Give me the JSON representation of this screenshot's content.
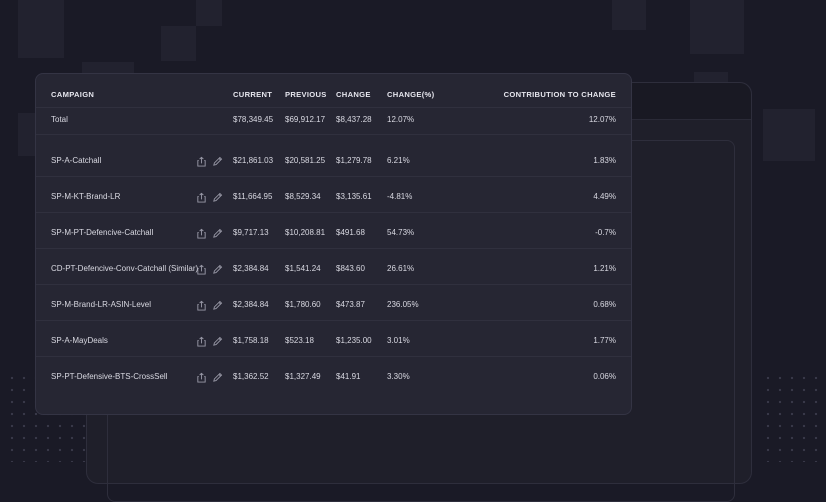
{
  "window": {
    "traffic_lights": [
      "#ff5f57",
      "#febc2e",
      "#28c840"
    ]
  },
  "table": {
    "headers": [
      "CAMPAIGN",
      "CURRENT",
      "PREVIOUS",
      "CHANGE",
      "CHANGE(%)",
      "CONTRIBUTION TO CHANGE"
    ],
    "total": {
      "campaign": "Total",
      "current": "$78,349.45",
      "previous": "$69,912.17",
      "change": "$8,437.28",
      "change_pct": "12.07%",
      "contribution": "12.07%"
    },
    "rows": [
      {
        "campaign": "SP-A-Catchall",
        "current": "$21,861.03",
        "previous": "$20,581.25",
        "change": "$1,279.78",
        "change_pct": "6.21%",
        "contribution": "1.83%"
      },
      {
        "campaign": "SP-M-KT-Brand-LR",
        "current": "$11,664.95",
        "previous": "$8,529.34",
        "change": "$3,135.61",
        "change_pct": "-4.81%",
        "contribution": "4.49%"
      },
      {
        "campaign": "SP-M-PT-Defencive-Catchall",
        "current": "$9,717.13",
        "previous": "$10,208.81",
        "change": "$491.68",
        "change_pct": "54.73%",
        "contribution": "-0.7%"
      },
      {
        "campaign": "CD-PT-Defencive-Conv-Catchall (Similar)",
        "current": "$2,384.84",
        "previous": "$1,541.24",
        "change": "$843.60",
        "change_pct": "26.61%",
        "contribution": "1.21%"
      },
      {
        "campaign": "SP-M-Brand-LR-ASIN-Level",
        "current": "$2,384.84",
        "previous": "$1,780.60",
        "change": "$473.87",
        "change_pct": "236.05%",
        "contribution": "0.68%"
      },
      {
        "campaign": "SP-A-MayDeals",
        "current": "$1,758.18",
        "previous": "$523.18",
        "change": "$1,235.00",
        "change_pct": "3.01%",
        "contribution": "1.77%"
      },
      {
        "campaign": "SP-PT-Defensive-BTS-CrossSell",
        "current": "$1,362.52",
        "previous": "$1,327.49",
        "change": "$41.91",
        "change_pct": "3.30%",
        "contribution": "0.06%"
      }
    ],
    "row_icons": [
      "share-icon",
      "edit-icon"
    ]
  }
}
